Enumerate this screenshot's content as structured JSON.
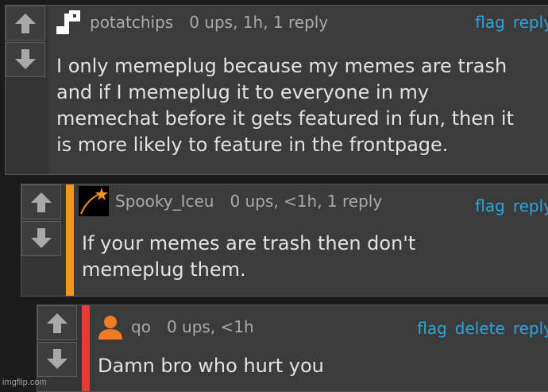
{
  "comments": [
    {
      "username": "potatchips",
      "meta": "0 ups, 1h, 1 reply",
      "actions": [
        "flag",
        "reply"
      ],
      "lines": [
        "I only memeplug because my memes are trash",
        "and if I memeplug it to everyone in my",
        "memechat before it gets featured in fun, then it",
        "is more likely to feature in the frontpage."
      ],
      "avatar_icon": "blocky-logo-icon"
    },
    {
      "username": "Spooky_Iceu",
      "meta": "0 ups, <1h, 1 reply",
      "actions": [
        "flag",
        "reply"
      ],
      "lines": [
        "If your memes are trash then don't",
        "memeplug them."
      ],
      "accent_color": "#f7931e",
      "avatar_icon": "shooting-star-icon"
    },
    {
      "username": "qo",
      "meta": "0 ups, <1h",
      "actions": [
        "flag",
        "delete",
        "reply"
      ],
      "lines": [
        "Damn bro who hurt you"
      ],
      "accent_color": "#e53935",
      "avatar_icon": "user-silhouette-icon"
    }
  ],
  "watermark": "imgflip.com",
  "colors": {
    "link": "#27a6e0",
    "text": "#e2e2e2",
    "muted": "#aaaaaa"
  }
}
